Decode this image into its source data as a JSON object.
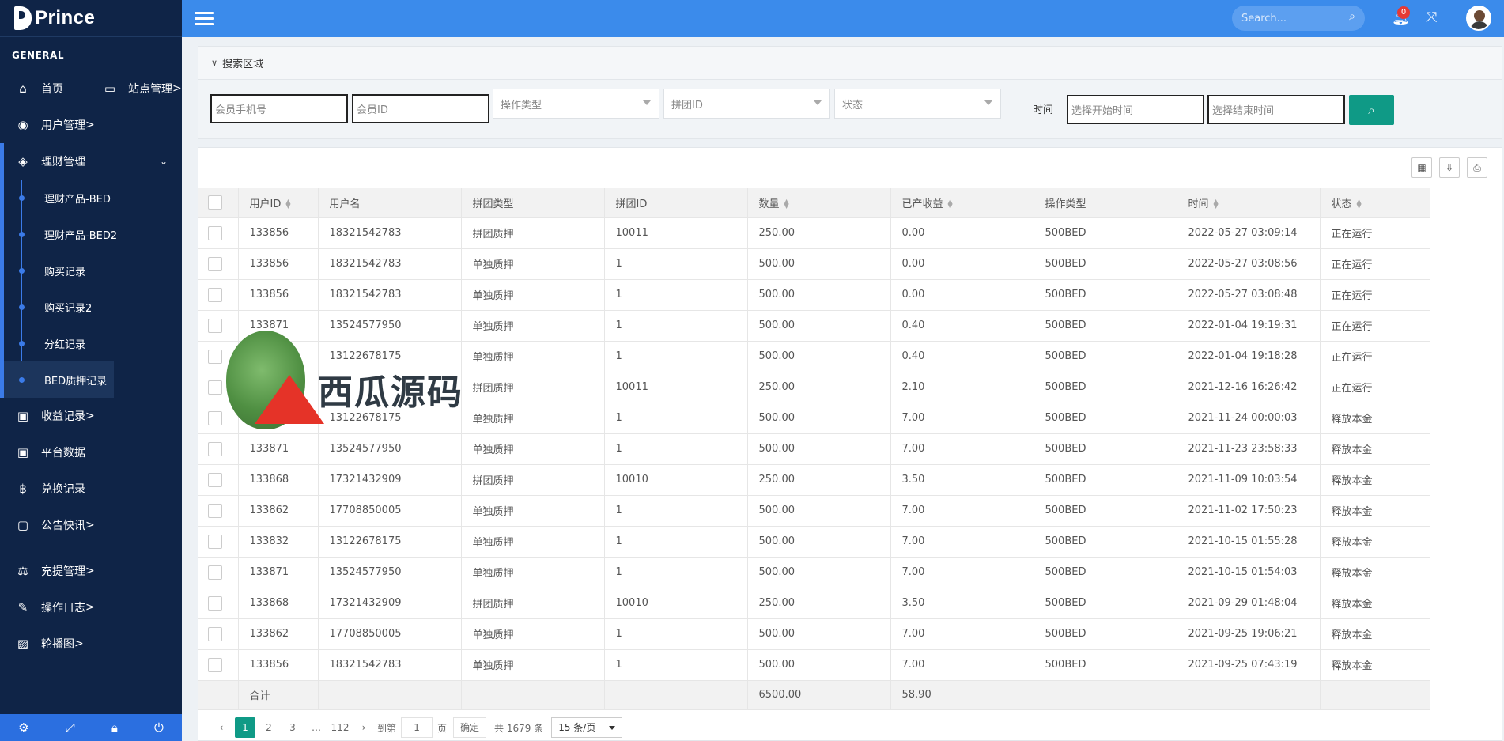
{
  "brand": {
    "name": "Prince"
  },
  "sidebar": {
    "group": "GENERAL",
    "home": "首页",
    "site": "站点管理",
    "user": "用户管理",
    "finance": "理财管理",
    "sub": [
      "理财产品-BED",
      "理财产品-BED2",
      "购买记录",
      "购买记录2",
      "分红记录",
      "BED质押记录"
    ],
    "income": "收益记录",
    "platform": "平台数据",
    "exchange": "兑换记录",
    "notice": "公告快讯",
    "recharge": "充提管理",
    "oplog": "操作日志",
    "carousel": "轮播图",
    "arrow": ">"
  },
  "topbar": {
    "search_placeholder": "Search...",
    "notifications": "0"
  },
  "filters": {
    "title": "搜索区域",
    "phone": "会员手机号",
    "member_id": "会员ID",
    "op_type": "操作类型",
    "group_id": "拼团ID",
    "status": "状态",
    "time_label": "时间",
    "start_time": "选择开始时间",
    "end_time": "选择结束时间"
  },
  "table": {
    "headers": [
      "用户ID",
      "用户名",
      "拼团类型",
      "拼团ID",
      "数量",
      "已产收益",
      "操作类型",
      "时间",
      "状态"
    ],
    "rows": [
      [
        "133856",
        "18321542783",
        "拼团质押",
        "10011",
        "250.00",
        "0.00",
        "500BED",
        "2022-05-27 03:09:14",
        "正在运行"
      ],
      [
        "133856",
        "18321542783",
        "单独质押",
        "1",
        "500.00",
        "0.00",
        "500BED",
        "2022-05-27 03:08:56",
        "正在运行"
      ],
      [
        "133856",
        "18321542783",
        "单独质押",
        "1",
        "500.00",
        "0.00",
        "500BED",
        "2022-05-27 03:08:48",
        "正在运行"
      ],
      [
        "133871",
        "13524577950",
        "单独质押",
        "1",
        "500.00",
        "0.40",
        "500BED",
        "2022-01-04 19:19:31",
        "正在运行"
      ],
      [
        "",
        "13122678175",
        "单独质押",
        "1",
        "500.00",
        "0.40",
        "500BED",
        "2022-01-04 19:18:28",
        "正在运行"
      ],
      [
        "",
        "",
        "拼团质押",
        "10011",
        "250.00",
        "2.10",
        "500BED",
        "2021-12-16 16:26:42",
        "正在运行"
      ],
      [
        "",
        "13122678175",
        "单独质押",
        "1",
        "500.00",
        "7.00",
        "500BED",
        "2021-11-24 00:00:03",
        "释放本金"
      ],
      [
        "133871",
        "13524577950",
        "单独质押",
        "1",
        "500.00",
        "7.00",
        "500BED",
        "2021-11-23 23:58:33",
        "释放本金"
      ],
      [
        "133868",
        "17321432909",
        "拼团质押",
        "10010",
        "250.00",
        "3.50",
        "500BED",
        "2021-11-09 10:03:54",
        "释放本金"
      ],
      [
        "133862",
        "17708850005",
        "单独质押",
        "1",
        "500.00",
        "7.00",
        "500BED",
        "2021-11-02 17:50:23",
        "释放本金"
      ],
      [
        "133832",
        "13122678175",
        "单独质押",
        "1",
        "500.00",
        "7.00",
        "500BED",
        "2021-10-15 01:55:28",
        "释放本金"
      ],
      [
        "133871",
        "13524577950",
        "单独质押",
        "1",
        "500.00",
        "7.00",
        "500BED",
        "2021-10-15 01:54:03",
        "释放本金"
      ],
      [
        "133868",
        "17321432909",
        "拼团质押",
        "10010",
        "250.00",
        "3.50",
        "500BED",
        "2021-09-29 01:48:04",
        "释放本金"
      ],
      [
        "133862",
        "17708850005",
        "单独质押",
        "1",
        "500.00",
        "7.00",
        "500BED",
        "2021-09-25 19:06:21",
        "释放本金"
      ],
      [
        "133856",
        "18321542783",
        "单独质押",
        "1",
        "500.00",
        "7.00",
        "500BED",
        "2021-09-25 07:43:19",
        "释放本金"
      ]
    ],
    "footer": {
      "label": "合计",
      "qty": "6500.00",
      "income": "58.90"
    }
  },
  "pagination": {
    "pages": [
      "1",
      "2",
      "3",
      "…",
      "112"
    ],
    "goto": "到第",
    "goto_value": "1",
    "page": "页",
    "confirm": "确定",
    "total": "共 1679 条",
    "per_page": "15 条/页"
  },
  "watermark": {
    "text": "西瓜源码"
  }
}
